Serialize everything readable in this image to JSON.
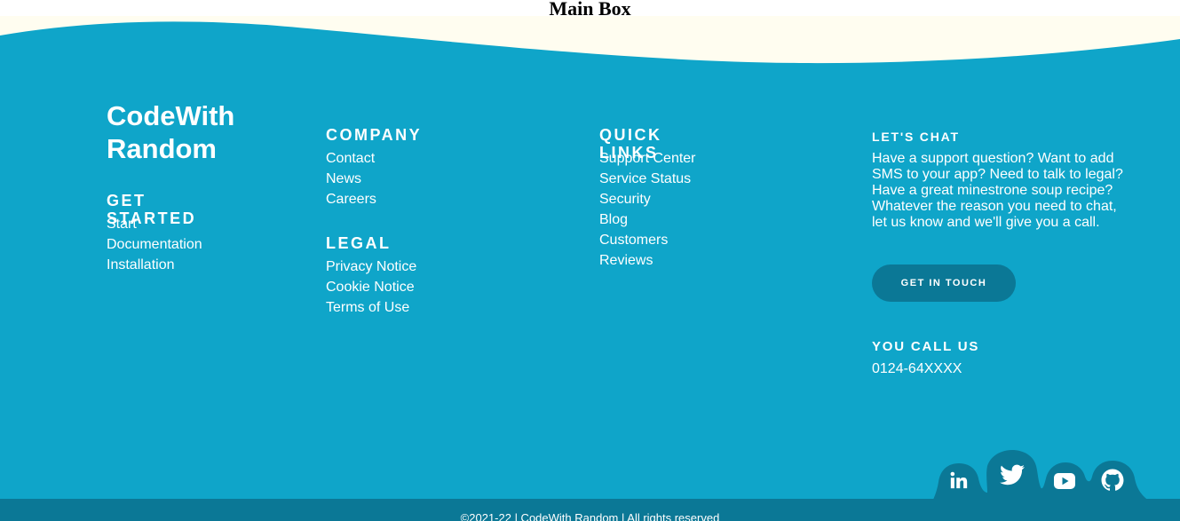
{
  "page": {
    "title": "Main Box"
  },
  "colors": {
    "footer_bg": "#0fa5c9",
    "dark_accent": "#0b7896",
    "cream": "#fffdf0",
    "text": "#ffffff"
  },
  "brand": {
    "line1": "CodeWith",
    "line2": "Random"
  },
  "get_started": {
    "heading": "GET STARTED",
    "items": [
      "Start",
      "Documentation",
      "Installation"
    ]
  },
  "company": {
    "heading": "COMPANY",
    "items": [
      "Contact",
      "News",
      "Careers"
    ]
  },
  "legal": {
    "heading": "LEGAL",
    "items": [
      "Privacy Notice",
      "Cookie Notice",
      "Terms of Use"
    ]
  },
  "quick_links": {
    "heading": "QUICK LINKS",
    "items": [
      "Support Center",
      "Service Status",
      "Security",
      "Blog",
      "Customers",
      "Reviews"
    ]
  },
  "chat": {
    "heading": "LET'S CHAT",
    "text": "Have a support question? Want to add SMS to your app? Need to talk to legal? Have a great minestrone soup recipe? Whatever the reason you need to chat, let us know and we'll give you a call.",
    "button": "GET IN TOUCH"
  },
  "call": {
    "heading": "YOU CALL US",
    "phone": "0124-64XXXX"
  },
  "social": [
    "linkedin-icon",
    "twitter-icon",
    "youtube-icon",
    "github-icon"
  ],
  "copyright": "©2021-22 | CodeWith Random | All rights reserved"
}
